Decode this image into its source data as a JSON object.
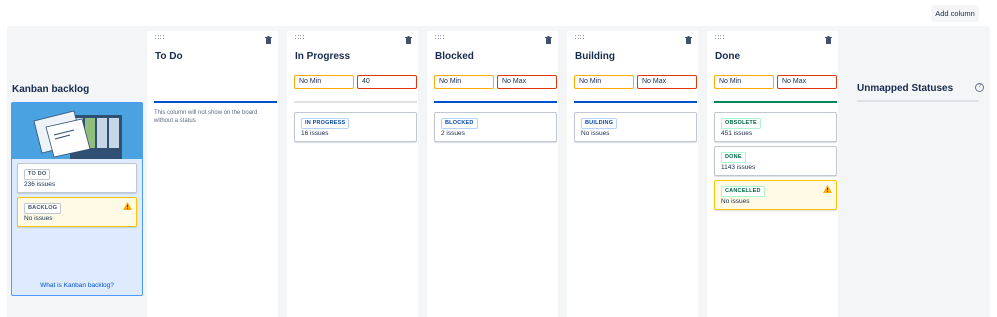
{
  "toolbar": {
    "add_column_label": "Add column"
  },
  "backlog": {
    "title": "Kanban backlog",
    "statuses": [
      {
        "label": "TO DO",
        "issues": "236 issues",
        "style": "gray",
        "warning": false
      },
      {
        "label": "BACKLOG",
        "issues": "No issues",
        "style": "gray",
        "warning": true
      }
    ],
    "link": "What is Kanban backlog?"
  },
  "columns": [
    {
      "title": "To Do",
      "min": null,
      "max": null,
      "bar_color": "#0052cc",
      "note": "This column will not show on the board without a status",
      "statuses": []
    },
    {
      "title": "In Progress",
      "min": "No Min",
      "max": "40",
      "bar_color": "#dfe1e6",
      "statuses": [
        {
          "label": "IN PROGRESS",
          "issues": "16 issues",
          "style": "blue",
          "warning": false
        }
      ]
    },
    {
      "title": "Blocked",
      "min": "No Min",
      "max": "No Max",
      "bar_color": "#0052cc",
      "statuses": [
        {
          "label": "BLOCKED",
          "issues": "2 issues",
          "style": "blue",
          "warning": false
        }
      ]
    },
    {
      "title": "Building",
      "min": "No Min",
      "max": "No Max",
      "bar_color": "#0052cc",
      "statuses": [
        {
          "label": "BUILDING",
          "issues": "No issues",
          "style": "blue",
          "warning": false
        }
      ]
    },
    {
      "title": "Done",
      "min": "No Min",
      "max": "No Max",
      "bar_color": "#00875a",
      "statuses": [
        {
          "label": "OBSOLETE",
          "issues": "451 issues",
          "style": "green",
          "warning": false
        },
        {
          "label": "DONE",
          "issues": "1143 issues",
          "style": "green",
          "warning": false
        },
        {
          "label": "CANCELLED",
          "issues": "No issues",
          "style": "green",
          "warning": true
        }
      ]
    }
  ],
  "unmapped": {
    "title": "Unmapped Statuses",
    "help_icon": "question-circle-icon"
  },
  "colors": {
    "accent": "#0052cc",
    "done": "#00875a",
    "warning": "#ffab00",
    "limit": "#de350b"
  }
}
